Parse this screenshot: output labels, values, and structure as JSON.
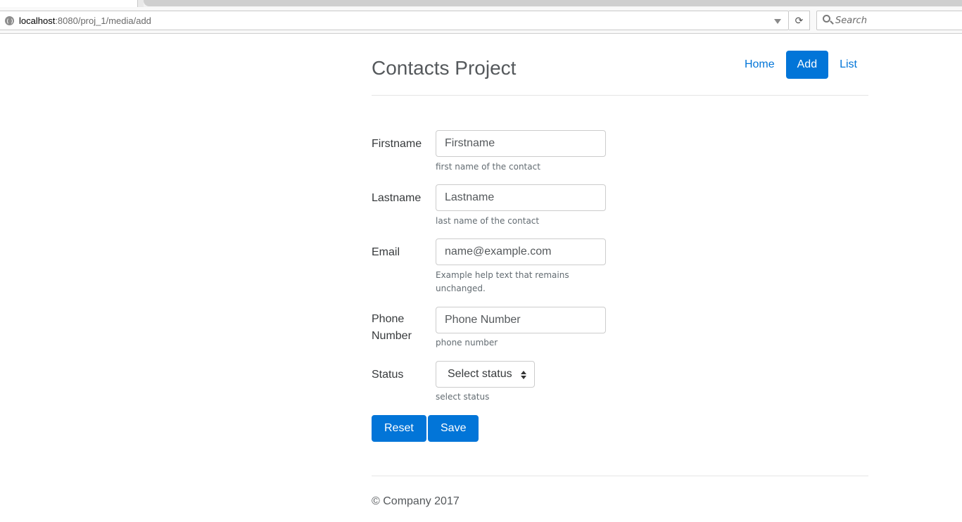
{
  "browser": {
    "url_host": "localhost",
    "url_path": ":8080/proj_1/media/add",
    "search_placeholder": "Search"
  },
  "header": {
    "brand": "Contacts Project",
    "nav": [
      {
        "label": "Home",
        "active": false
      },
      {
        "label": "Add",
        "active": true
      },
      {
        "label": "List",
        "active": false
      }
    ]
  },
  "form": {
    "firstname": {
      "label": "Firstname",
      "placeholder": "Firstname",
      "value": "",
      "help": "first name of the contact"
    },
    "lastname": {
      "label": "Lastname",
      "placeholder": "Lastname",
      "value": "",
      "help": "last name of the contact"
    },
    "email": {
      "label": "Email",
      "placeholder": "name@example.com",
      "value": "",
      "help": "Example help text that remains unchanged."
    },
    "phone": {
      "label_line1": "Phone",
      "label_line2": "Number",
      "placeholder": "Phone Number",
      "value": "",
      "help": "phone number"
    },
    "status": {
      "label": "Status",
      "selected": "Select status",
      "help": "select status"
    },
    "reset_label": "Reset",
    "save_label": "Save"
  },
  "footer": {
    "text": "© Company 2017"
  },
  "colors": {
    "primary": "#0275d8",
    "brand_text": "#55595c",
    "help_text": "#636c72",
    "rule": "#e5e5e5"
  }
}
